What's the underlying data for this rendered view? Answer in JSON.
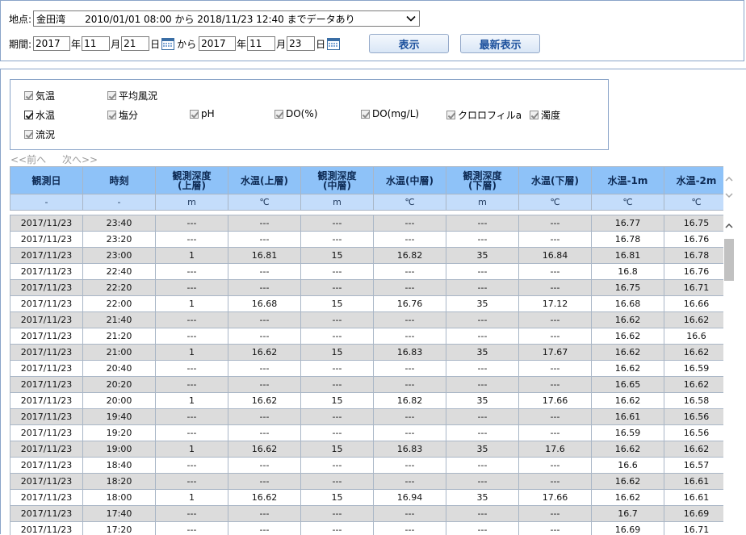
{
  "filter": {
    "location_label": "地点:",
    "location_name": "金田湾",
    "location_range": "2010/01/01 08:00 から 2018/11/23 12:40 までデータあり",
    "period_label": "期間:",
    "start": {
      "year": "2017",
      "month": "11",
      "day": "21"
    },
    "end": {
      "year": "2017",
      "month": "11",
      "day": "23"
    },
    "unit_year": "年",
    "unit_month": "月",
    "unit_day": "日",
    "from_label": "から",
    "show_button": "表示",
    "latest_button": "最新表示"
  },
  "params": [
    {
      "label": "気温",
      "checked": true,
      "enabled": false
    },
    {
      "label": "平均風況",
      "checked": true,
      "enabled": false
    },
    {
      "label": "水温",
      "checked": true,
      "enabled": true
    },
    {
      "label": "塩分",
      "checked": true,
      "enabled": false
    },
    {
      "label": "pH",
      "checked": true,
      "enabled": false
    },
    {
      "label": "DO(%)",
      "checked": true,
      "enabled": false
    },
    {
      "label": "DO(mg/L)",
      "checked": true,
      "enabled": false
    },
    {
      "label": "クロロフィルa",
      "checked": true,
      "enabled": false
    },
    {
      "label": "濁度",
      "checked": true,
      "enabled": false
    },
    {
      "label": "流況",
      "checked": true,
      "enabled": false
    }
  ],
  "pager": {
    "prev": "<<前へ",
    "next": "次へ>>"
  },
  "table": {
    "headers": [
      "観測日",
      "時刻",
      "観測深度\n(上層)",
      "水温(上層)",
      "観測深度\n(中層)",
      "水温(中層)",
      "観測深度\n(下層)",
      "水温(下層)",
      "水温-1m",
      "水温-2m"
    ],
    "units": [
      "-",
      "-",
      "m",
      "℃",
      "m",
      "℃",
      "m",
      "℃",
      "℃",
      "℃"
    ],
    "rows": [
      [
        "2017/11/23",
        "23:40",
        "---",
        "---",
        "---",
        "---",
        "---",
        "---",
        "16.77",
        "16.75"
      ],
      [
        "2017/11/23",
        "23:20",
        "---",
        "---",
        "---",
        "---",
        "---",
        "---",
        "16.78",
        "16.76"
      ],
      [
        "2017/11/23",
        "23:00",
        "1",
        "16.81",
        "15",
        "16.82",
        "35",
        "16.84",
        "16.81",
        "16.78"
      ],
      [
        "2017/11/23",
        "22:40",
        "---",
        "---",
        "---",
        "---",
        "---",
        "---",
        "16.8",
        "16.76"
      ],
      [
        "2017/11/23",
        "22:20",
        "---",
        "---",
        "---",
        "---",
        "---",
        "---",
        "16.75",
        "16.71"
      ],
      [
        "2017/11/23",
        "22:00",
        "1",
        "16.68",
        "15",
        "16.76",
        "35",
        "17.12",
        "16.68",
        "16.66"
      ],
      [
        "2017/11/23",
        "21:40",
        "---",
        "---",
        "---",
        "---",
        "---",
        "---",
        "16.62",
        "16.62"
      ],
      [
        "2017/11/23",
        "21:20",
        "---",
        "---",
        "---",
        "---",
        "---",
        "---",
        "16.62",
        "16.6"
      ],
      [
        "2017/11/23",
        "21:00",
        "1",
        "16.62",
        "15",
        "16.83",
        "35",
        "17.67",
        "16.62",
        "16.62"
      ],
      [
        "2017/11/23",
        "20:40",
        "---",
        "---",
        "---",
        "---",
        "---",
        "---",
        "16.62",
        "16.59"
      ],
      [
        "2017/11/23",
        "20:20",
        "---",
        "---",
        "---",
        "---",
        "---",
        "---",
        "16.65",
        "16.62"
      ],
      [
        "2017/11/23",
        "20:00",
        "1",
        "16.62",
        "15",
        "16.82",
        "35",
        "17.66",
        "16.62",
        "16.58"
      ],
      [
        "2017/11/23",
        "19:40",
        "---",
        "---",
        "---",
        "---",
        "---",
        "---",
        "16.61",
        "16.56"
      ],
      [
        "2017/11/23",
        "19:20",
        "---",
        "---",
        "---",
        "---",
        "---",
        "---",
        "16.59",
        "16.56"
      ],
      [
        "2017/11/23",
        "19:00",
        "1",
        "16.62",
        "15",
        "16.83",
        "35",
        "17.6",
        "16.62",
        "16.62"
      ],
      [
        "2017/11/23",
        "18:40",
        "---",
        "---",
        "---",
        "---",
        "---",
        "---",
        "16.6",
        "16.57"
      ],
      [
        "2017/11/23",
        "18:20",
        "---",
        "---",
        "---",
        "---",
        "---",
        "---",
        "16.62",
        "16.61"
      ],
      [
        "2017/11/23",
        "18:00",
        "1",
        "16.62",
        "15",
        "16.94",
        "35",
        "17.66",
        "16.62",
        "16.61"
      ],
      [
        "2017/11/23",
        "17:40",
        "---",
        "---",
        "---",
        "---",
        "---",
        "---",
        "16.7",
        "16.69"
      ],
      [
        "2017/11/23",
        "17:20",
        "---",
        "---",
        "---",
        "---",
        "---",
        "---",
        "16.69",
        "16.71"
      ]
    ]
  },
  "colors": {
    "header_bg": "#8ec2f8",
    "unit_bg": "#c4ddfb",
    "grey_row": "#dcdcdc",
    "panel_border": "#8aa4c8"
  }
}
